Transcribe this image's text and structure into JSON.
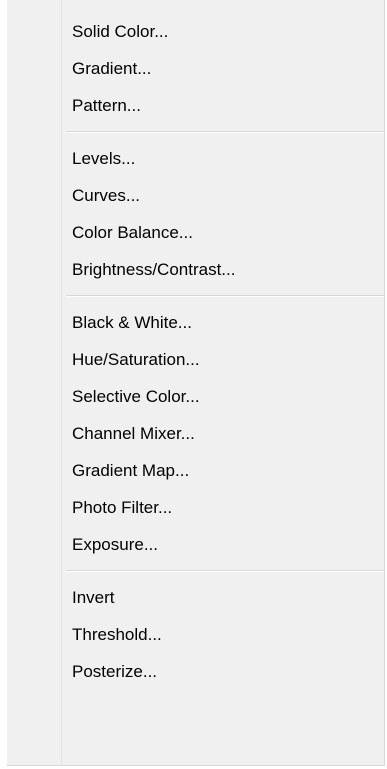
{
  "menu": {
    "groups": [
      {
        "items": [
          "Solid Color...",
          "Gradient...",
          "Pattern..."
        ]
      },
      {
        "items": [
          "Levels...",
          "Curves...",
          "Color Balance...",
          "Brightness/Contrast..."
        ]
      },
      {
        "items": [
          "Black & White...",
          "Hue/Saturation...",
          "Selective Color...",
          "Channel Mixer...",
          "Gradient Map...",
          "Photo Filter...",
          "Exposure..."
        ]
      },
      {
        "items": [
          "Invert",
          "Threshold...",
          "Posterize..."
        ]
      }
    ]
  }
}
